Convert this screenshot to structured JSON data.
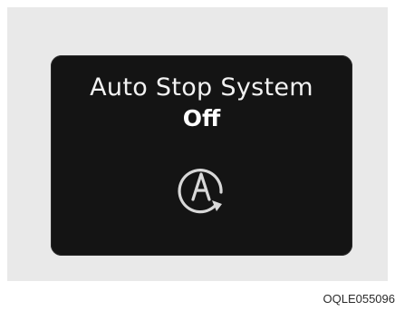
{
  "display": {
    "title": "Auto Stop System",
    "status": "Off",
    "icon": "auto-stop-icon"
  },
  "caption": "OQLE055096",
  "colors": {
    "screen": "#141414",
    "text": "#f2f2f2",
    "background": "#e9e9e9"
  }
}
